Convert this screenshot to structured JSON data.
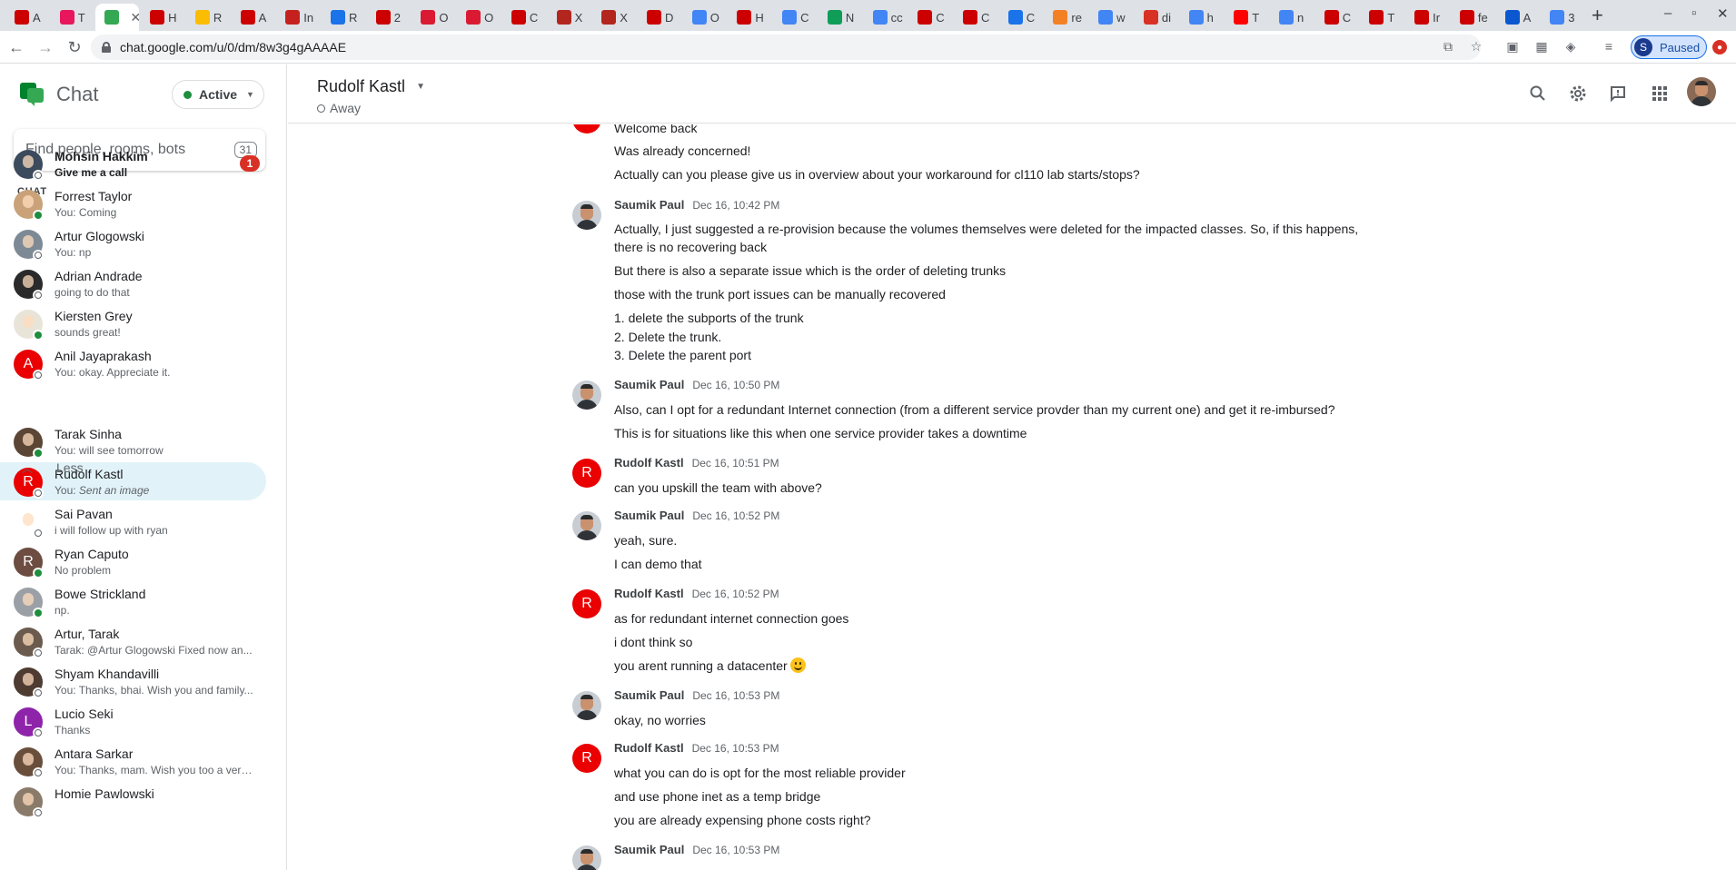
{
  "browser": {
    "tabs": [
      {
        "label": "A",
        "icon": "redhat-icon",
        "color": "#cc0000"
      },
      {
        "label": "T",
        "icon": "target-icon",
        "color": "#e8175d"
      },
      {
        "label": "",
        "icon": "google-chat-icon",
        "color": "#34a853",
        "active": true
      },
      {
        "label": "H",
        "icon": "redhat-icon",
        "color": "#cc0000"
      },
      {
        "label": "R",
        "icon": "google-drive-icon",
        "color": "#fbbc04"
      },
      {
        "label": "A",
        "icon": "redhat-icon",
        "color": "#cc0000"
      },
      {
        "label": "In",
        "icon": "gmail-icon",
        "color": "#c5221f"
      },
      {
        "label": "R",
        "icon": "calendar-icon",
        "color": "#1a73e8"
      },
      {
        "label": "2",
        "icon": "redhat-icon",
        "color": "#cc0000"
      },
      {
        "label": "O",
        "icon": "openstack-icon",
        "color": "#da1a32"
      },
      {
        "label": "O",
        "icon": "openstack-icon",
        "color": "#da1a32"
      },
      {
        "label": "C",
        "icon": "redhat-icon",
        "color": "#cc0000"
      },
      {
        "label": "X",
        "icon": "xc-icon",
        "color": "#b3261e"
      },
      {
        "label": "X",
        "icon": "xc-icon",
        "color": "#b3261e"
      },
      {
        "label": "D",
        "icon": "redhat-icon",
        "color": "#cc0000"
      },
      {
        "label": "O",
        "icon": "google-icon",
        "color": "#4285f4"
      },
      {
        "label": "H",
        "icon": "redhat-icon",
        "color": "#cc0000"
      },
      {
        "label": "C",
        "icon": "google-icon",
        "color": "#4285f4"
      },
      {
        "label": "N",
        "icon": "sheets-icon",
        "color": "#0f9d58"
      },
      {
        "label": "cc",
        "icon": "google-icon",
        "color": "#4285f4"
      },
      {
        "label": "C",
        "icon": "redhat-icon",
        "color": "#cc0000"
      },
      {
        "label": "C",
        "icon": "redhat-icon",
        "color": "#cc0000"
      },
      {
        "label": "C",
        "icon": "globe-icon",
        "color": "#1a73e8"
      },
      {
        "label": "re",
        "icon": "stack-icon",
        "color": "#f48024"
      },
      {
        "label": "w",
        "icon": "google-icon",
        "color": "#4285f4"
      },
      {
        "label": "di",
        "icon": "ask-icon",
        "color": "#d93025"
      },
      {
        "label": "h",
        "icon": "google-icon",
        "color": "#4285f4"
      },
      {
        "label": "T",
        "icon": "youtube-icon",
        "color": "#ff0000"
      },
      {
        "label": "n",
        "icon": "google-icon",
        "color": "#4285f4"
      },
      {
        "label": "C",
        "icon": "redhat-icon",
        "color": "#cc0000"
      },
      {
        "label": "T",
        "icon": "redhat-icon",
        "color": "#cc0000"
      },
      {
        "label": "Ir",
        "icon": "redhat-icon",
        "color": "#cc0000"
      },
      {
        "label": "fe",
        "icon": "redhat-icon",
        "color": "#cc0000"
      },
      {
        "label": "A",
        "icon": "u-icon",
        "color": "#0b57d0"
      },
      {
        "label": "3",
        "icon": "google-icon",
        "color": "#4285f4"
      }
    ],
    "url": "chat.google.com/u/0/dm/8w3g4gAAAAE",
    "profile_label": "Paused",
    "profile_initial": "S"
  },
  "sidebar": {
    "app_name": "Chat",
    "status_label": "Active",
    "search_placeholder": "Find people, rooms, bots",
    "search_count": "31",
    "section_label": "CHAT",
    "less_label": "Less",
    "conversations": [
      {
        "name": "Mohsin Hakkim",
        "preview": "Give me a call",
        "unread": true,
        "badge": "1",
        "avatar": "photo",
        "avatar_color": "#3b4a5c",
        "online": false
      },
      {
        "name": "Forrest Taylor",
        "preview": "You: Coming",
        "avatar": "photo",
        "avatar_color": "#c9a27a",
        "online": true
      },
      {
        "name": "Artur Glogowski",
        "preview": "You: np",
        "avatar": "photo",
        "avatar_color": "#7d8a96",
        "online": false
      },
      {
        "name": "Adrian Andrade",
        "preview": "going to do that",
        "avatar": "photo",
        "avatar_color": "#2a2a2a",
        "online": false
      },
      {
        "name": "Kiersten Grey",
        "preview": "sounds great!",
        "avatar": "photo",
        "avatar_color": "#e8e4d8",
        "online": true
      },
      {
        "name": "Anil Jayaprakash",
        "preview": "You: okay. Appreciate it.",
        "avatar": "A",
        "avatar_color": "#ea0000",
        "online": false
      },
      {
        "name": "Tarak Sinha",
        "preview": "You: will see tomorrow",
        "avatar": "photo",
        "avatar_color": "#5b4636",
        "online": true
      },
      {
        "name": "Rudolf Kastl",
        "preview_prefix": "You: ",
        "preview": "Sent an image",
        "preview_italic": true,
        "selected": true,
        "avatar": "R",
        "avatar_color": "#ea0000",
        "online": false
      },
      {
        "name": "Sai Pavan",
        "preview": "i will follow up with ryan",
        "avatar": "photo",
        "avatar_color": "#ffffff",
        "online": false
      },
      {
        "name": "Ryan Caputo",
        "preview": "No problem",
        "avatar": "R",
        "avatar_color": "#6d4c41",
        "online": true
      },
      {
        "name": "Bowe Strickland",
        "preview": "np.",
        "avatar": "photo",
        "avatar_color": "#9aa0a6",
        "online": true
      },
      {
        "name": "Artur, Tarak",
        "preview": "Tarak: @Artur Glogowski Fixed now an...",
        "avatar": "photo",
        "avatar_color": "#6b5b4e",
        "online": false
      },
      {
        "name": "Shyam Khandavilli",
        "preview": "You: Thanks, bhai. Wish you and family...",
        "avatar": "photo",
        "avatar_color": "#4e3b31",
        "online": false
      },
      {
        "name": "Lucio Seki",
        "preview": "Thanks",
        "avatar": "L",
        "avatar_color": "#8e24aa",
        "online": false
      },
      {
        "name": "Antara Sarkar",
        "preview": "You: Thanks, mam. Wish you too a very...",
        "avatar": "photo",
        "avatar_color": "#6a4e3c",
        "online": false
      },
      {
        "name": "Homie Pawlowski",
        "preview": "",
        "avatar": "photo",
        "avatar_color": "#8a7a6a",
        "online": false
      }
    ]
  },
  "header": {
    "title": "Rudolf Kastl",
    "status": "Away"
  },
  "thread": {
    "partial_top": [
      "Welcome back",
      "Was already concerned!",
      "Actually can you please give us in overview about your workaround for cl110 lab starts/stops?"
    ],
    "messages": [
      {
        "sender": "Saumik Paul",
        "time": "Dec 16, 10:42 PM",
        "avatar": "saumik",
        "lines": [
          "Actually, I just suggested a re-provision because the volumes themselves were deleted for the impacted classes. So, if this happens, there is no recovering back",
          "But there is also a separate issue which is the order of deleting trunks",
          "those with the trunk port issues can be manually recovered",
          "1. delete the subports of the trunk",
          "2. Delete the trunk.",
          "3. Delete the parent port"
        ]
      },
      {
        "sender": "Saumik Paul",
        "time": "Dec 16, 10:50 PM",
        "avatar": "saumik",
        "lines": [
          "Also, can I opt for a redundant Internet connection (from a different service provder than my current one) and get it re-imbursed?",
          "This is for situations like this when one service provider takes a downtime"
        ]
      },
      {
        "sender": "Rudolf Kastl",
        "time": "Dec 16, 10:51 PM",
        "avatar": "R",
        "lines": [
          "can you upskill the team with above?"
        ]
      },
      {
        "sender": "Saumik Paul",
        "time": "Dec 16, 10:52 PM",
        "avatar": "saumik",
        "lines": [
          "yeah, sure.",
          "I can demo that"
        ]
      },
      {
        "sender": "Rudolf Kastl",
        "time": "Dec 16, 10:52 PM",
        "avatar": "R",
        "lines": [
          "as for redundant internet connection goes",
          "i dont think so",
          "you arent running a datacenter"
        ]
      },
      {
        "sender": "Saumik Paul",
        "time": "Dec 16, 10:53 PM",
        "avatar": "saumik",
        "lines": [
          "okay, no worries"
        ]
      },
      {
        "sender": "Rudolf Kastl",
        "time": "Dec 16, 10:53 PM",
        "avatar": "R",
        "lines": [
          "what you can do is opt for the most reliable provider",
          "and use phone inet as a temp bridge",
          "you are already expensing phone costs right?"
        ]
      },
      {
        "sender": "Saumik Paul",
        "time": "Dec 16, 10:53 PM",
        "avatar": "saumik",
        "lines": []
      }
    ]
  },
  "colors": {
    "accent_red": "#ea0000",
    "online_green": "#1e8e3e",
    "selected_bg": "#e1f3f8",
    "badge_red": "#d93025"
  }
}
